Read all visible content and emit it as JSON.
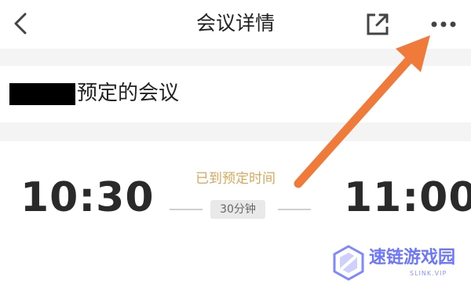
{
  "header": {
    "title": "会议详情",
    "back_icon": "chevron-left-icon",
    "share_icon": "share-external-icon",
    "more_icon": "more-horizontal-icon"
  },
  "organizer": {
    "suffix_text": "预定的会议"
  },
  "meeting": {
    "start_time": "10:30",
    "end_time": "11:00",
    "status": "已到预定时间",
    "duration": "30分钟"
  },
  "annotation": {
    "arrow_color": "#f07a3a"
  },
  "watermark": {
    "title": "速链游戏园",
    "subtitle": "SLINK.VIP"
  },
  "colors": {
    "status_text": "#d6a85c",
    "time_text": "#2a2a2a",
    "section_gap": "#f4f4f4",
    "watermark": "#6c76ff"
  }
}
